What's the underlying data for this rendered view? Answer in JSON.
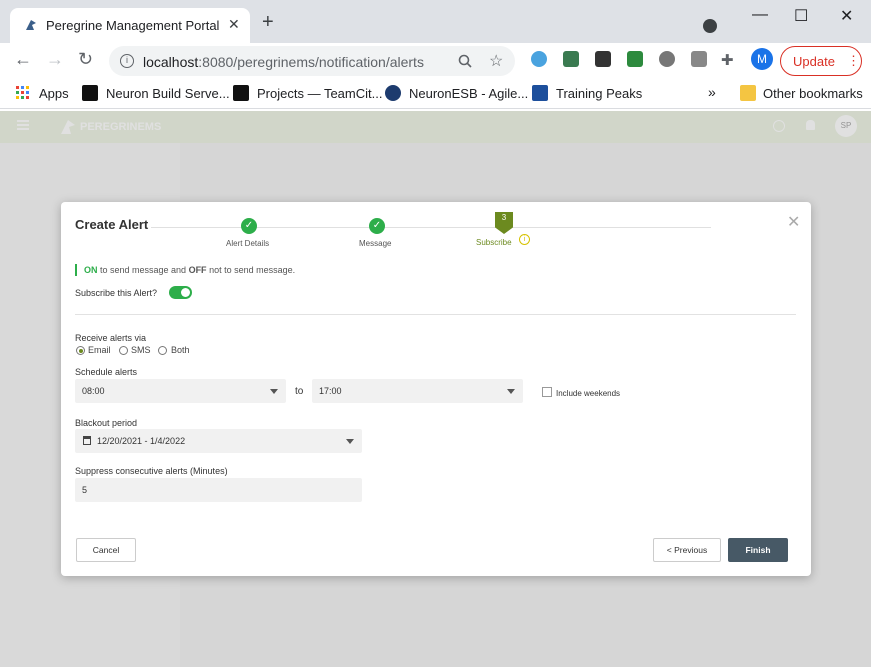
{
  "browser": {
    "tab_title": "Peregrine Management Portal",
    "tab_close": "✕",
    "new_tab": "+",
    "window_controls": [
      "—",
      "☐",
      "✕"
    ],
    "url_host": "localhost",
    "url_rest": ":8080/peregrinems/notification/alerts",
    "profile_initial": "M",
    "update_label": "Update",
    "bookmarks": [
      "Apps",
      "Neuron Build Serve...",
      "Projects — TeamCit...",
      "NeuronESB - Agile...",
      "Training Peaks"
    ],
    "bookmark_overflow": "»",
    "other_bookmarks": "Other bookmarks"
  },
  "app": {
    "brand": "PEREGRINEMS",
    "user_initials": "SP"
  },
  "modal": {
    "title": "Create Alert",
    "close": "✕",
    "steps": [
      {
        "label": "Alert Details",
        "status": "done"
      },
      {
        "label": "Message",
        "status": "done"
      },
      {
        "label": "Subscribe",
        "status": "current",
        "number": "3"
      }
    ],
    "info_on": "ON",
    "info_mid": " to send message and ",
    "info_off": "OFF",
    "info_end": " not to send message.",
    "subscribe_label": "Subscribe this Alert?",
    "subscribe_on": true,
    "receive_label": "Receive alerts via",
    "receive_options": [
      "Email",
      "SMS",
      "Both"
    ],
    "receive_selected": "Email",
    "schedule_label": "Schedule alerts",
    "schedule_from": "08:00",
    "schedule_to_word": "to",
    "schedule_to": "17:00",
    "include_weekends": "Include weekends",
    "blackout_label": "Blackout period",
    "blackout_value": "12/20/2021 - 1/4/2022",
    "suppress_label": "Suppress consecutive alerts (Minutes)",
    "suppress_value": "5",
    "cancel_label": "Cancel",
    "previous_label": "< Previous",
    "finish_label": "Finish"
  },
  "colors": {
    "accent": "#2dae4a",
    "brand": "#6c8a1f",
    "finish": "#475966"
  }
}
